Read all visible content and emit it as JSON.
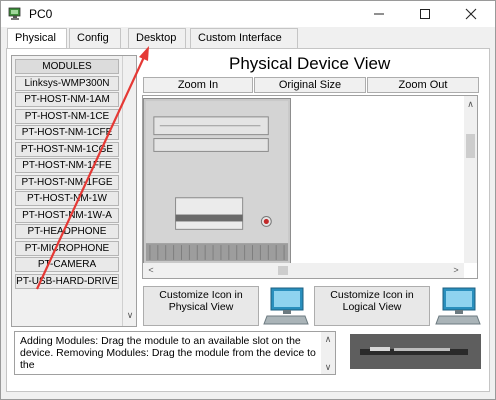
{
  "window": {
    "title": "PC0"
  },
  "tabs": [
    {
      "label": "Physical"
    },
    {
      "label": "Config"
    },
    {
      "label": "Desktop"
    },
    {
      "label": "Custom Interface"
    }
  ],
  "modules": {
    "header": "MODULES",
    "items": [
      "Linksys-WMP300N",
      "PT-HOST-NM-1AM",
      "PT-HOST-NM-1CE",
      "PT-HOST-NM-1CFE",
      "PT-HOST-NM-1CGE",
      "PT-HOST-NM-1FFE",
      "PT-HOST-NM-1FGE",
      "PT-HOST-NM-1W",
      "PT-HOST-NM-1W-A",
      "PT-HEADPHONE",
      "PT-MICROPHONE",
      "PT-CAMERA",
      "PT-USB-HARD-DRIVE"
    ]
  },
  "device_view": {
    "title": "Physical Device View",
    "zoom_in": "Zoom In",
    "original_size": "Original Size",
    "zoom_out": "Zoom Out"
  },
  "customize": {
    "physical_label": "Customize Icon in Physical View",
    "logical_label": "Customize Icon in Logical View"
  },
  "info": {
    "text": "Adding Modules: Drag the module to an available slot on the device. Removing Modules: Drag the module from the device to the"
  },
  "colors": {
    "highlight": "#e53935",
    "panel": "#f0f0f0",
    "device_body": "#c9c9c9",
    "monitor_blue": "#2a8fbd"
  },
  "icons": {
    "app": "pc-icon",
    "minimize": "minimize-icon",
    "maximize": "maximize-icon",
    "close": "close-icon"
  }
}
